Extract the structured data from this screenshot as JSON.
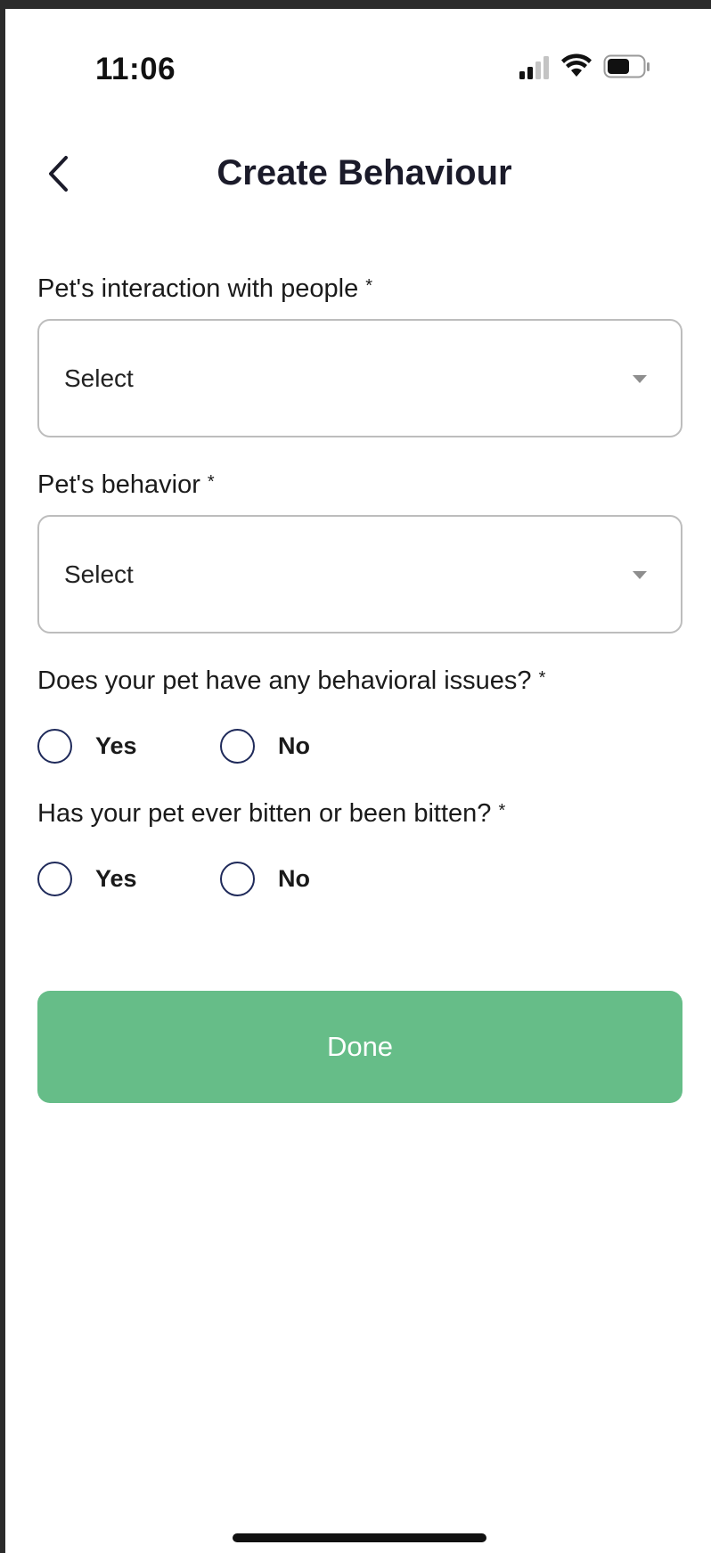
{
  "status_bar": {
    "time": "11:06"
  },
  "header": {
    "title": "Create Behaviour",
    "back_icon": "chevron-left-icon"
  },
  "form": {
    "required_marker": "*",
    "interaction_with_people": {
      "label": "Pet's interaction with people",
      "value": "Select"
    },
    "behavior": {
      "label": "Pet's behavior",
      "value": "Select"
    },
    "behavioral_issues": {
      "label": "Does your pet have any behavioral issues?",
      "options": [
        "Yes",
        "No"
      ],
      "selected": null
    },
    "bitten": {
      "label": "Has your pet ever bitten or been bitten?",
      "options": [
        "Yes",
        "No"
      ],
      "selected": null
    },
    "done_label": "Done"
  },
  "colors": {
    "accent": "#66bd88",
    "radio_border": "#1f2a5a",
    "title_text": "#1b1b2a"
  }
}
